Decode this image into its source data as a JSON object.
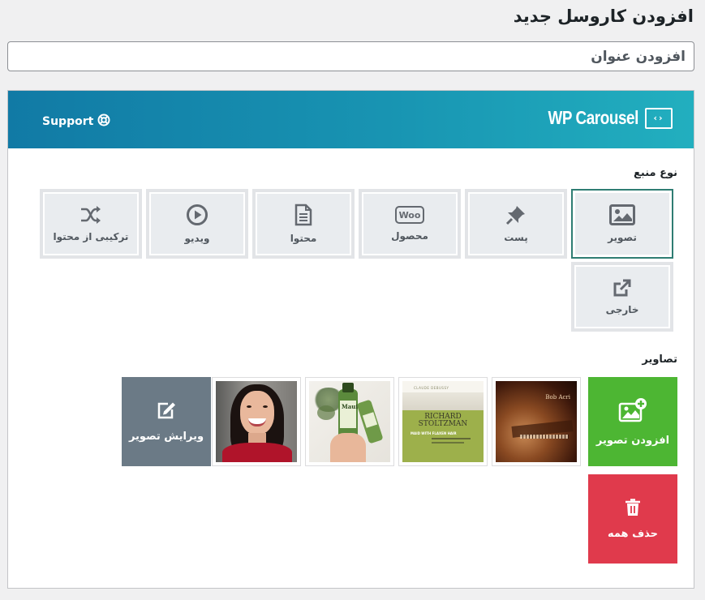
{
  "page": {
    "title": "افزودن کاروسل جدید"
  },
  "title_field": {
    "placeholder": "افزودن عنوان"
  },
  "banner": {
    "support_label": "Support",
    "logo_text": "WP Carousel",
    "logo_mark": "‹›"
  },
  "source": {
    "label": "نوع منبع",
    "selected": "تصویر",
    "items": [
      {
        "label": "تصویر",
        "icon": "image-icon"
      },
      {
        "label": "پست",
        "icon": "pin-icon"
      },
      {
        "label": "محصول",
        "icon": "woo-icon",
        "badge": "Woo"
      },
      {
        "label": "محتوا",
        "icon": "document-icon"
      },
      {
        "label": "ویدیو",
        "icon": "play-icon"
      },
      {
        "label": "ترکیبی از محتوا",
        "icon": "shuffle-icon"
      },
      {
        "label": "خارجی",
        "icon": "external-link-icon"
      }
    ]
  },
  "gallery": {
    "label": "تصاویر",
    "add_label": "افزودن تصویر",
    "delete_label": "حذف همه",
    "edit_label": "ویرایش تصویر",
    "thumbnails": [
      {
        "caption_top": "",
        "caption": "Bob Acri"
      },
      {
        "caption_top": "CLAUDE DEBUSSY",
        "caption": "RICHARD STOLTZMAN",
        "subtitle": "MAID WITH FLAXEN HAIR"
      },
      {
        "caption": "Maui"
      },
      {
        "caption": ""
      }
    ]
  },
  "colors": {
    "accent": "#2f7d73",
    "banner": "#1894b2",
    "add": "#4db633",
    "delete": "#e03a4c",
    "edit": "#6b7a86"
  }
}
